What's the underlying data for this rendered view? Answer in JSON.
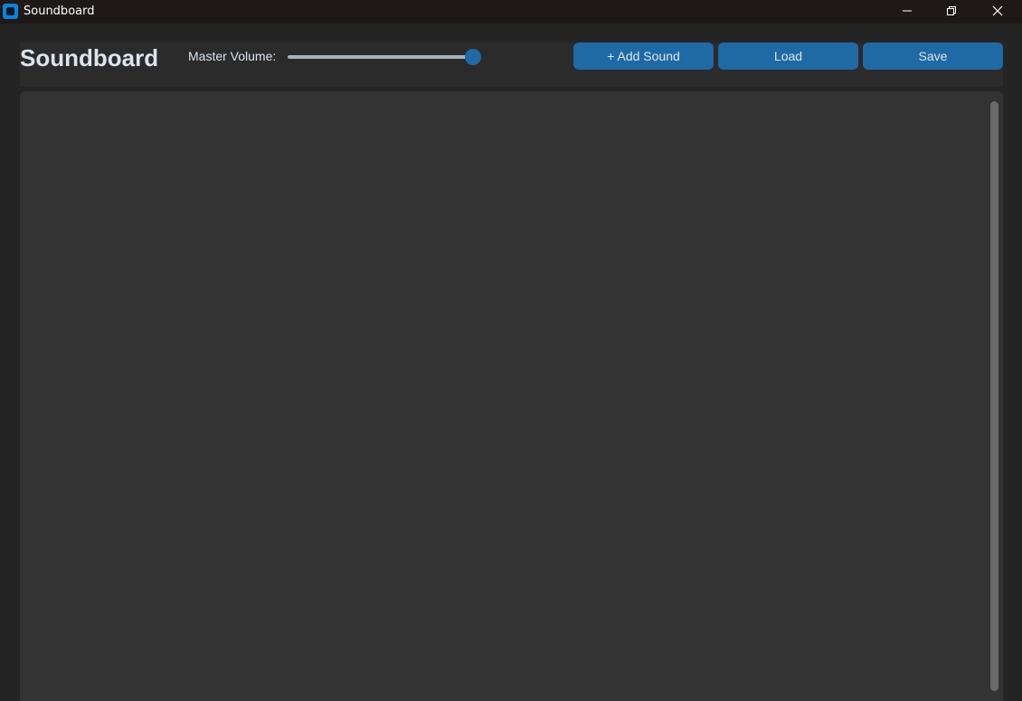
{
  "window": {
    "title": "Soundboard",
    "controls": [
      "minimize-icon",
      "restore-icon",
      "close-icon"
    ]
  },
  "toolbar": {
    "heading": "Soundboard",
    "volume_label": "Master Volume:",
    "volume_level": 1.0,
    "add_label": "+ Add Sound",
    "load_label": "Load",
    "save_label": "Save"
  },
  "colors": {
    "accent": "#1f6aa5",
    "titlebar": "#1e1818",
    "background": "#242424",
    "panel": "#333333",
    "toolbar": "#2b2b2b",
    "text": "#dce4ee",
    "scrollbar": "#696969"
  },
  "sound_list": {
    "items": []
  }
}
